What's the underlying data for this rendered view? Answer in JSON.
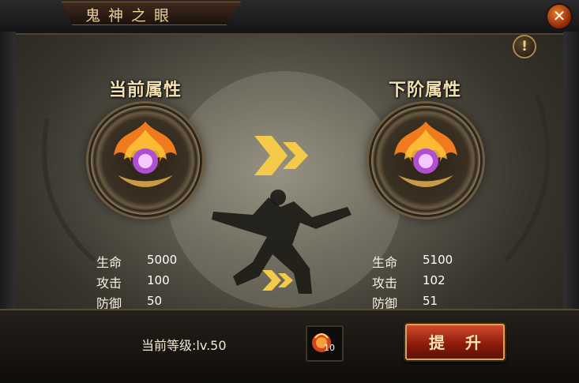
{
  "title": "鬼神之眼",
  "close_label": "✕",
  "info_label": "!",
  "current": {
    "title": "当前属性",
    "stats": [
      {
        "label": "生命",
        "value": "5000"
      },
      {
        "label": "攻击",
        "value": "100"
      },
      {
        "label": "防御",
        "value": "50"
      }
    ]
  },
  "next": {
    "title": "下阶属性",
    "stats": [
      {
        "label": "生命",
        "value": "5100"
      },
      {
        "label": "攻击",
        "value": "102"
      },
      {
        "label": "防御",
        "value": "51"
      }
    ]
  },
  "footer": {
    "level_text": "当前等级:lv.50",
    "item_count": "10",
    "upgrade_label": "提升"
  },
  "colors": {
    "accent_gold": "#f3d385",
    "button_red": "#8e1c0e",
    "arrow_yellow": "#f5c94a"
  }
}
